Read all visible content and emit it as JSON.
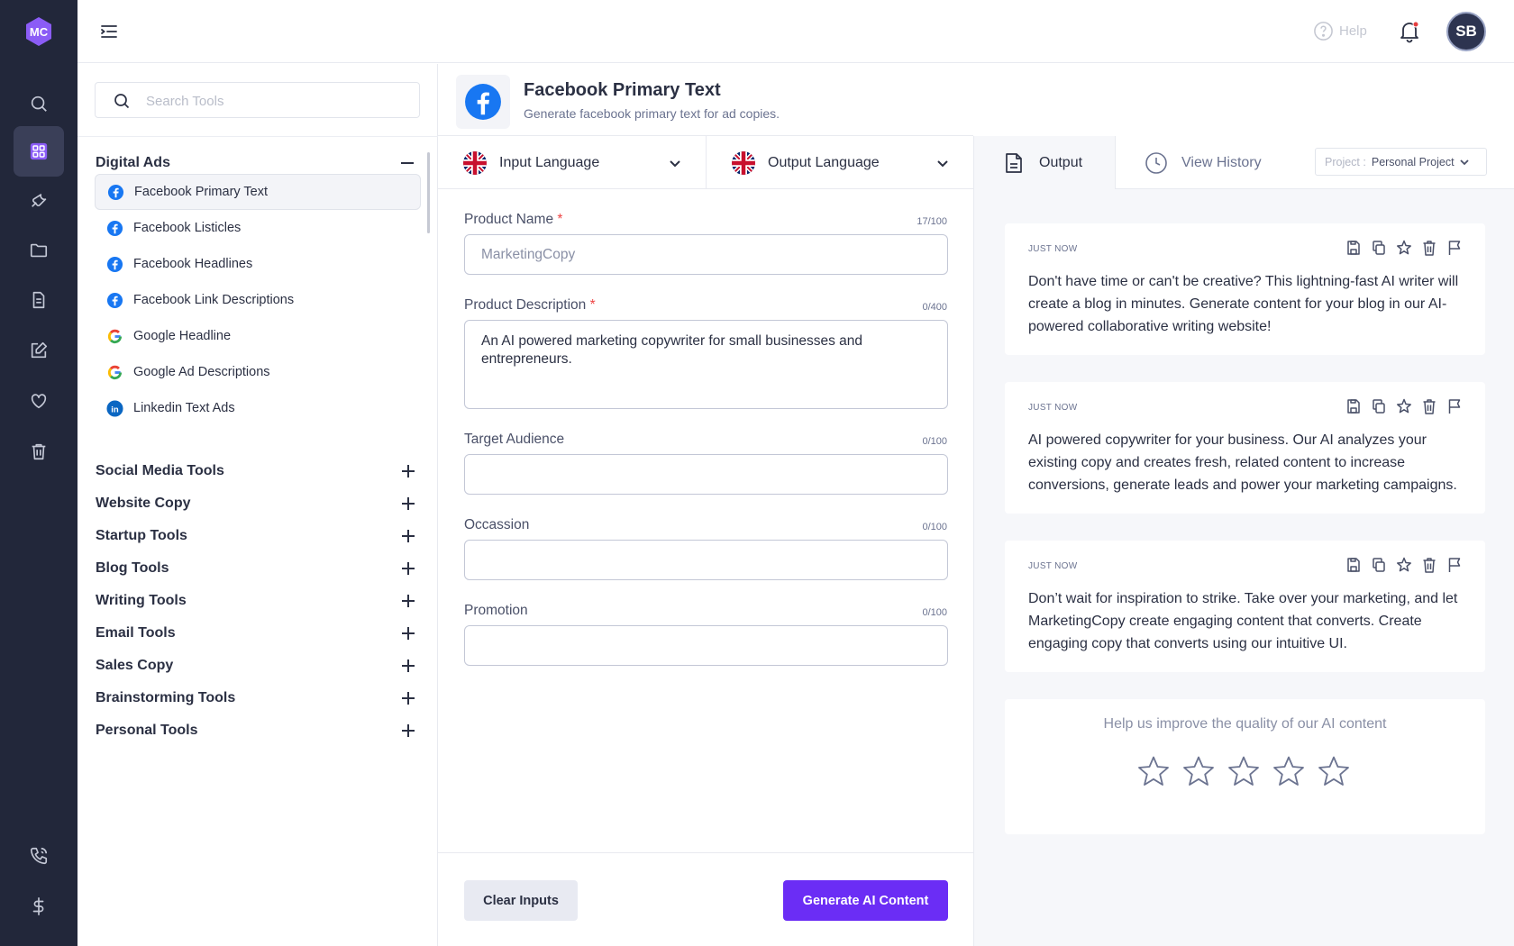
{
  "app": {
    "logo_text": "MC",
    "brand_color": "#6b2df5",
    "rail_color": "#22273a"
  },
  "rail": {
    "items": [
      {
        "icon": "search-icon"
      },
      {
        "icon": "grid-icon",
        "active": true
      },
      {
        "icon": "wrench-icon"
      },
      {
        "icon": "folder-icon"
      },
      {
        "icon": "document-icon"
      },
      {
        "icon": "edit-icon"
      },
      {
        "icon": "heart-icon"
      },
      {
        "icon": "trash-icon"
      }
    ],
    "bottom": [
      {
        "icon": "phone-icon"
      },
      {
        "icon": "dollar-icon"
      }
    ]
  },
  "topbar": {
    "help_label": "Help",
    "avatar_initials": "SB"
  },
  "sidebar": {
    "search_placeholder": "Search Tools",
    "open_category": "Digital Ads",
    "tools": [
      {
        "label": "Facebook Primary Text",
        "icon": "facebook-icon",
        "active": true
      },
      {
        "label": "Facebook Listicles",
        "icon": "facebook-icon"
      },
      {
        "label": "Facebook Headlines",
        "icon": "facebook-icon"
      },
      {
        "label": "Facebook Link Descriptions",
        "icon": "facebook-icon"
      },
      {
        "label": "Google Headline",
        "icon": "google-icon"
      },
      {
        "label": "Google Ad Descriptions",
        "icon": "google-icon"
      },
      {
        "label": "Linkedin Text Ads",
        "icon": "linkedin-icon"
      }
    ],
    "categories": [
      "Social Media Tools",
      "Website Copy",
      "Startup Tools",
      "Blog Tools",
      "Writing Tools",
      "Email Tools",
      "Sales Copy",
      "Brainstorming Tools",
      "Personal Tools"
    ]
  },
  "tool": {
    "title": "Facebook Primary Text",
    "subtitle": "Generate facebook primary text for ad copies."
  },
  "language": {
    "input_label": "Input Language",
    "output_label": "Output Language"
  },
  "form": {
    "fields": [
      {
        "label": "Product Name",
        "required": true,
        "counter": "17/100",
        "value": "MarketingCopy"
      },
      {
        "label": "Product Description",
        "required": true,
        "counter": "0/400",
        "value": "An AI powered marketing copywriter for small businesses and entrepreneurs."
      },
      {
        "label": "Target Audience",
        "required": false,
        "counter": "0/100",
        "value": ""
      },
      {
        "label": "Occassion",
        "required": false,
        "counter": "0/100",
        "value": ""
      },
      {
        "label": "Promotion",
        "required": false,
        "counter": "0/100",
        "value": ""
      }
    ],
    "clear_label": "Clear Inputs",
    "generate_label": "Generate AI Content"
  },
  "output": {
    "tab_output": "Output",
    "tab_history": "View History",
    "project_key": "Project :",
    "project_value": "Personal Project",
    "results": [
      {
        "time": "JUST NOW",
        "text": "Don't have time or can't be creative? This lightning-fast AI writer will create a blog in minutes. Generate content for your blog in our AI-powered collaborative writing website!"
      },
      {
        "time": "JUST NOW",
        "text": "AI powered copywriter for your business. Our AI analyzes your existing copy and creates fresh, related content to increase conversions, generate leads and power your marketing campaigns."
      },
      {
        "time": "JUST NOW",
        "text": "Don’t wait for inspiration to strike. Take over your marketing, and let MarketingCopy create engaging content that converts. Create engaging copy that converts using our intuitive UI."
      }
    ],
    "rating_prompt": "Help us improve the quality of our AI content",
    "rating_value": 0,
    "rating_max": 5
  }
}
